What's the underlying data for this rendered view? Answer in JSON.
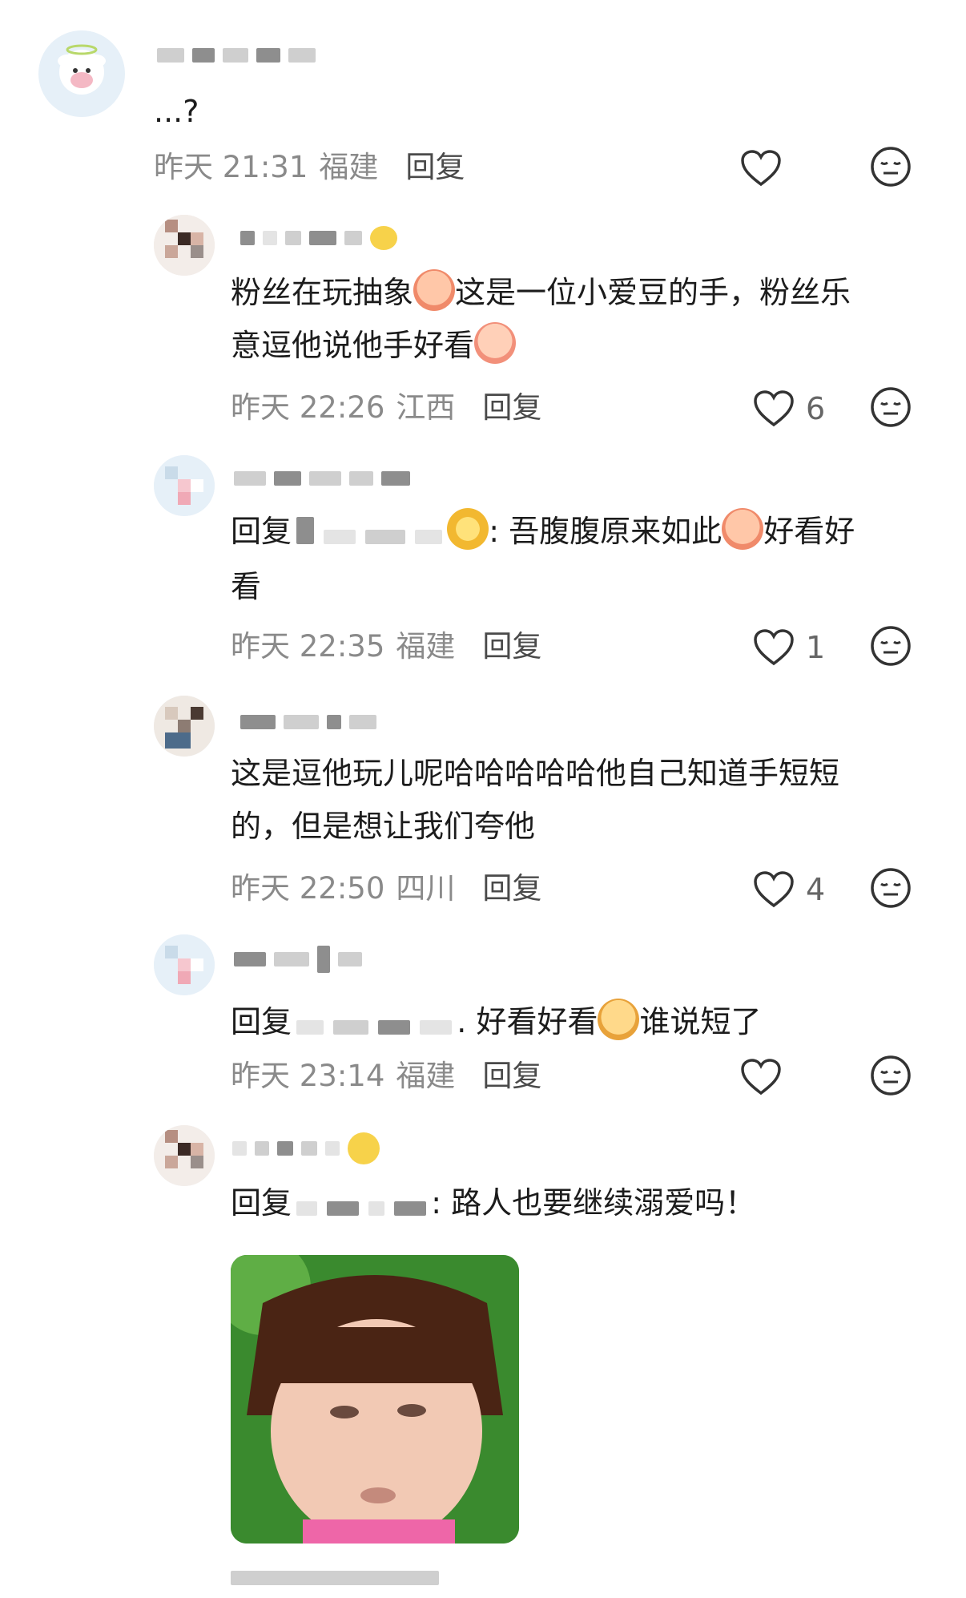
{
  "comments": [
    {
      "text": "...?",
      "time": "昨天 21:31",
      "location": "福建",
      "reply_label": "回复",
      "likes": ""
    },
    {
      "text_part1": "粉丝在玩抽象",
      "text_part2": "这是一位小爱豆的手，粉丝乐",
      "text_line2": "意逗他说他手好看",
      "time": "昨天 22:26",
      "location": "江西",
      "reply_label": "回复",
      "likes": "6"
    },
    {
      "reply_prefix": "回复",
      "text_part1": ": 吾腹腹原来如此",
      "text_part2": "好看好",
      "text_line2": "看",
      "time": "昨天 22:35",
      "location": "福建",
      "reply_label": "回复",
      "likes": "1"
    },
    {
      "text_line1": "这是逗他玩儿呢哈哈哈哈哈他自己知道手短短",
      "text_line2": "的，但是想让我们夸他",
      "time": "昨天 22:50",
      "location": "四川",
      "reply_label": "回复",
      "likes": "4"
    },
    {
      "reply_prefix": "回复",
      "text_part1": ". 好看好看",
      "text_part2": "谁说短了",
      "time": "昨天 23:14",
      "location": "福建",
      "reply_label": "回复",
      "likes": ""
    },
    {
      "reply_prefix": "回复",
      "text_part1": ": 路人也要继续溺爱吗！"
    }
  ],
  "icons": {
    "like": "heart-outline-icon",
    "reaction": "neutral-face-icon"
  },
  "colors": {
    "meta_text": "#8a8a8a",
    "body_text": "#1c1c1c"
  }
}
